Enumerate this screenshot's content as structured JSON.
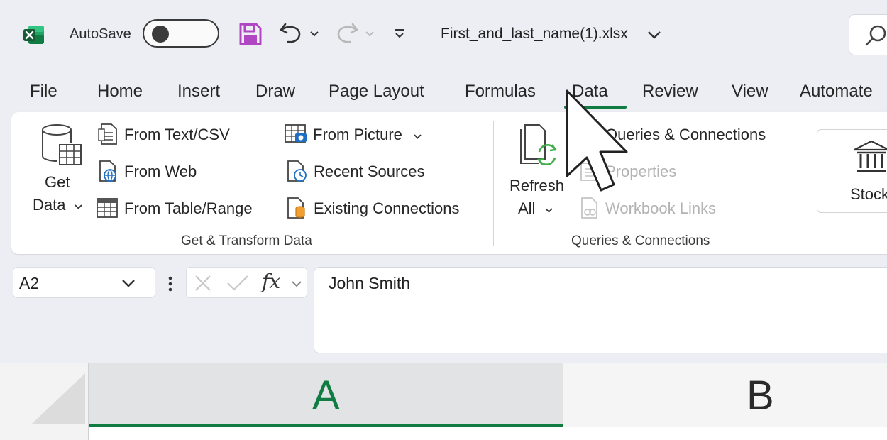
{
  "titlebar": {
    "autosave_label": "AutoSave",
    "file_name": "First_and_last_name(1).xlsx"
  },
  "tabs": [
    {
      "label": "File"
    },
    {
      "label": "Home"
    },
    {
      "label": "Insert"
    },
    {
      "label": "Draw"
    },
    {
      "label": "Page Layout"
    },
    {
      "label": "Formulas"
    },
    {
      "label": "Data",
      "active": true
    },
    {
      "label": "Review"
    },
    {
      "label": "View"
    },
    {
      "label": "Automate"
    }
  ],
  "ribbon": {
    "get_data": {
      "line1": "Get",
      "line2": "Data"
    },
    "get_transform": {
      "from_text_csv": "From Text/CSV",
      "from_web": "From Web",
      "from_table_range": "From Table/Range",
      "from_picture": "From Picture",
      "recent_sources": "Recent Sources",
      "existing_connections": "Existing Connections",
      "group_label": "Get & Transform Data"
    },
    "queries": {
      "refresh_line1": "Refresh",
      "refresh_line2": "All",
      "queries_connections": "Queries & Connections",
      "properties": "Properties",
      "workbook_links": "Workbook Links",
      "group_label": "Queries & Connections"
    },
    "data_types": {
      "stocks": "Stocks"
    }
  },
  "formula_bar": {
    "name_box": "A2",
    "fx": "fx",
    "content": "John Smith"
  },
  "grid": {
    "columns": [
      "A",
      "B"
    ],
    "selected_column": "A"
  },
  "colors": {
    "accent": "#107c41",
    "excel_green": "#1d6f42",
    "save_purple": "#b146c2"
  },
  "icons": [
    "excel-logo-icon",
    "save-icon",
    "undo-icon",
    "redo-icon",
    "search-icon",
    "mouse-pointer-icon"
  ]
}
